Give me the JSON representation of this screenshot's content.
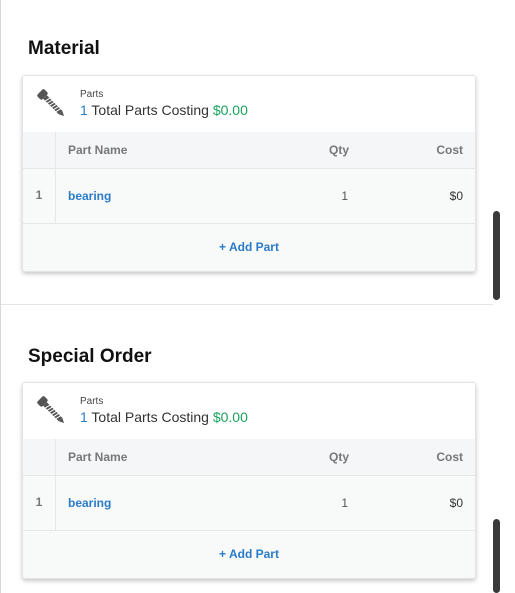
{
  "sections": [
    {
      "title": "Material",
      "card": {
        "label": "Parts",
        "count": "1",
        "summary_text": " Total Parts Costing ",
        "total_cost": "$0.00",
        "columns": {
          "name": "Part Name",
          "qty": "Qty",
          "cost": "Cost"
        },
        "rows": [
          {
            "index": "1",
            "name": "bearing",
            "qty": "1",
            "cost": "$0"
          }
        ],
        "add_label": "+ Add Part"
      }
    },
    {
      "title": "Special Order",
      "card": {
        "label": "Parts",
        "count": "1",
        "summary_text": " Total Parts Costing ",
        "total_cost": "$0.00",
        "columns": {
          "name": "Part Name",
          "qty": "Qty",
          "cost": "Cost"
        },
        "rows": [
          {
            "index": "1",
            "name": "bearing",
            "qty": "1",
            "cost": "$0"
          }
        ],
        "add_label": "+ Add Part"
      }
    }
  ],
  "icons": {
    "parts": "screw-icon"
  },
  "colors": {
    "link": "#2a7bc8",
    "cost_green": "#1aa35c"
  }
}
